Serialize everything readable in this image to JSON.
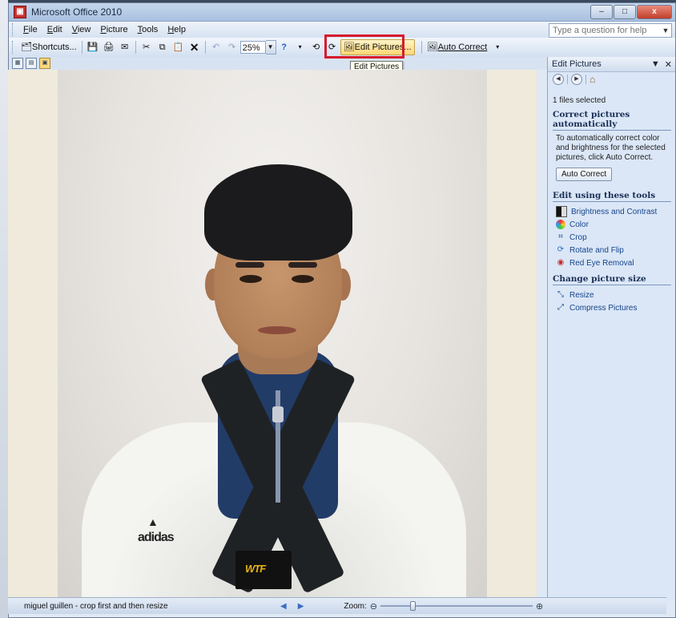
{
  "window": {
    "title": "Microsoft Office 2010"
  },
  "window_controls": {
    "minimize": "–",
    "maximize": "□",
    "close": "x"
  },
  "menu": [
    {
      "pre": "",
      "u": "F",
      "post": "ile"
    },
    {
      "pre": "",
      "u": "E",
      "post": "dit"
    },
    {
      "pre": "",
      "u": "V",
      "post": "iew"
    },
    {
      "pre": "",
      "u": "P",
      "post": "icture"
    },
    {
      "pre": "",
      "u": "T",
      "post": "ools"
    },
    {
      "pre": "",
      "u": "H",
      "post": "elp"
    }
  ],
  "help": {
    "placeholder": "Type a question for help"
  },
  "toolbar": {
    "shortcuts_label": "Shortcuts...",
    "zoom_value": "25%",
    "edit_pictures_label": "Edit Pictures...",
    "auto_correct_label": "Auto Correct"
  },
  "tooltip": {
    "text": "Edit Pictures"
  },
  "pane": {
    "title": "Edit Pictures",
    "files_selected": "1 files selected",
    "section1_head": "Correct pictures automatically",
    "section1_text": "To automatically correct color and brightness for the selected pictures, click Auto Correct.",
    "auto_correct_button": "Auto Correct",
    "section2_head": "Edit using these tools",
    "tools": [
      {
        "label": "Brightness and Contrast",
        "icon": "brightness-icon"
      },
      {
        "label": "Color",
        "icon": "color-wheel-icon"
      },
      {
        "label": "Crop",
        "icon": "crop-icon"
      },
      {
        "label": "Rotate and Flip",
        "icon": "rotate-icon"
      },
      {
        "label": "Red Eye Removal",
        "icon": "red-eye-icon"
      }
    ],
    "section3_head": "Change picture size",
    "size_tools": [
      {
        "label": "Resize",
        "icon": "resize-icon"
      },
      {
        "label": "Compress Pictures",
        "icon": "compress-icon"
      }
    ]
  },
  "status": {
    "text": "miguel guillen - crop first and then resize",
    "zoom_label": "Zoom:",
    "zoom_fraction": 0.2
  },
  "photo": {
    "logo_text": "adidas",
    "badge_text": "WTF"
  },
  "colors": {
    "highlight": "#d7192d",
    "link": "#16448a"
  }
}
